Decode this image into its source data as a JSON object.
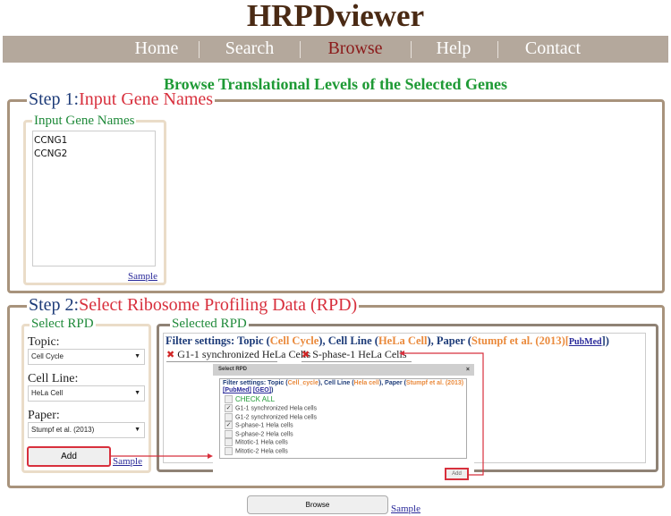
{
  "app": {
    "title": "HRPDviewer"
  },
  "nav": {
    "items": [
      {
        "label": "Home"
      },
      {
        "label": "Search"
      },
      {
        "label": "Browse",
        "active": true
      },
      {
        "label": "Help"
      },
      {
        "label": "Contact"
      }
    ]
  },
  "page_heading": "Browse Translational Levels of the Selected Genes",
  "step1": {
    "prefix": "Step 1:",
    "title": "Input Gene Names",
    "inner_legend": "Input Gene Names",
    "genes": "CCNG1\nCCNG2",
    "sample_link": "Sample"
  },
  "step2": {
    "prefix": "Step 2:",
    "title": "Select Ribosome Profiling Data (RPD)",
    "select_rpd": {
      "legend": "Select RPD",
      "topic_label": "Topic:",
      "topic_value": "Cell Cycle",
      "cell_line_label": "Cell Line:",
      "cell_line_value": "HeLa Cell",
      "paper_label": "Paper:",
      "paper_value": "Stumpf et al. (2013)",
      "add_button": "Add",
      "sample_link": "Sample"
    },
    "selected_rpd": {
      "legend": "Selected RPD",
      "filter": {
        "prefix": "Filter settings: Topic (",
        "topic": "Cell Cycle",
        "mid1": "), Cell Line (",
        "cell_line": "HeLa Cell",
        "mid2": "), Paper (",
        "paper": "Stumpf et al. (2013)",
        "pubmed": "PubMed",
        "suffix": "])"
      },
      "tags": [
        "G1-1 synchronized HeLa Cells",
        "S-phase-1 HeLa Cells"
      ]
    },
    "dialog": {
      "title": "Select RPD",
      "close": "×",
      "filter": {
        "prefix": "Filter settings: Topic (",
        "topic": "Cell_cycle",
        "mid1": "), Cell Line (",
        "cell_line": "Hela cell",
        "mid2": "), Paper (",
        "paper": "Stumpf et al. (2013)",
        "pubmed": "[PubMed]",
        "geo": "[GEO]",
        "suffix": ")"
      },
      "check_all": "CHECK ALL",
      "options": [
        {
          "label": "G1-1 synchronized Hela cells",
          "checked": true
        },
        {
          "label": "G1-2 synchronized Hela cells",
          "checked": false
        },
        {
          "label": "S-phase-1 Hela cells",
          "checked": true
        },
        {
          "label": "S-phase-2 Hela cells",
          "checked": false
        },
        {
          "label": "Mitotic-1 Hela cells",
          "checked": false
        },
        {
          "label": "Mitotic-2 Hela cells",
          "checked": false
        }
      ],
      "add_button": "Add"
    }
  },
  "footer": {
    "browse_button": "Browse",
    "sample_link": "Sample"
  },
  "colors": {
    "nav_bg": "#b4a89c",
    "active_nav": "#8b1a1a",
    "heading": "#1e9a35",
    "highlight": "#d8303d",
    "step_border": "#a8937c"
  }
}
